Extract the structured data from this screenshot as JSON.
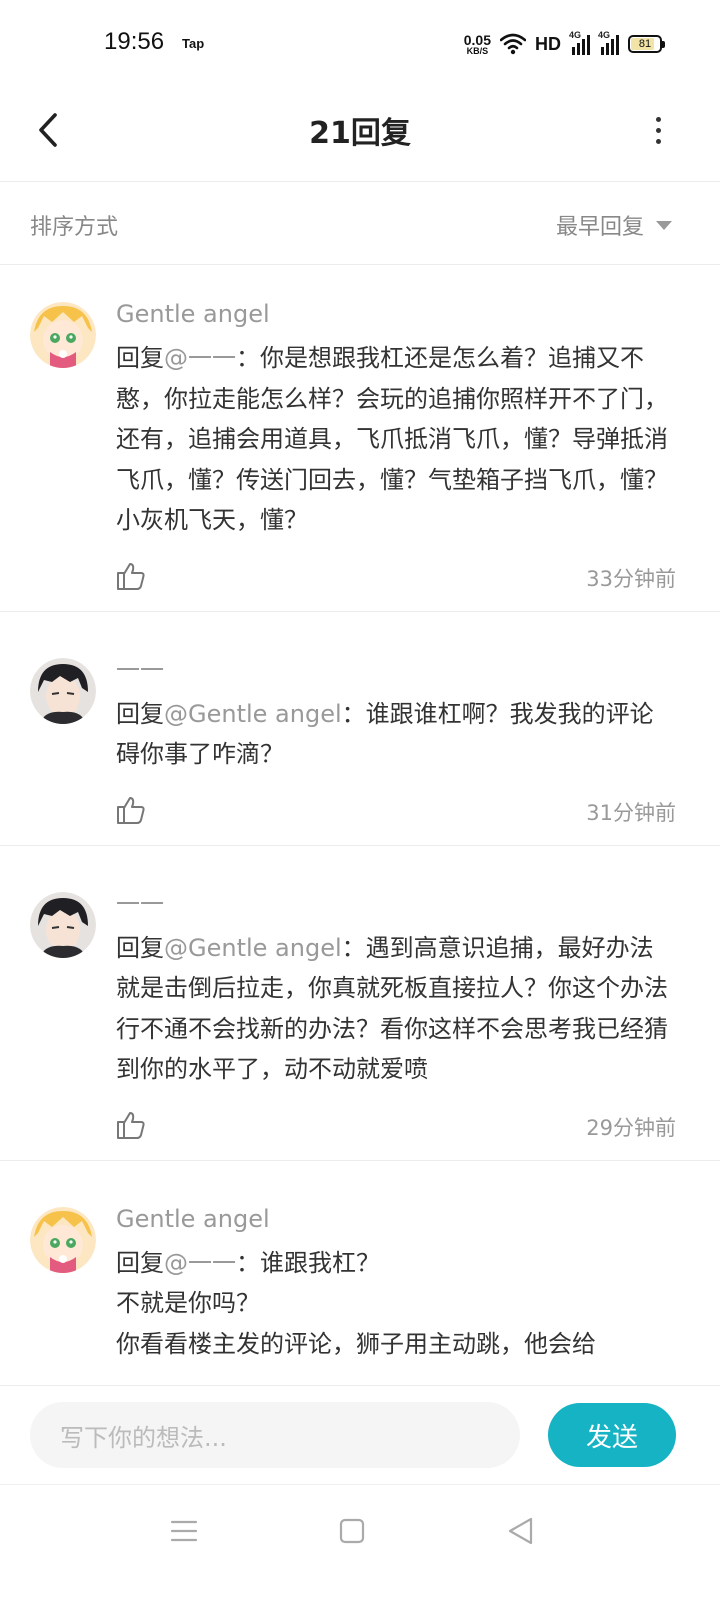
{
  "status_bar": {
    "time": "19:56",
    "app_label": "Tap",
    "net_speed_value": "0.05",
    "net_speed_unit": "KB/S",
    "hd_label": "HD",
    "sim1_label": "4G",
    "sim2_label": "4G",
    "battery_level": "81"
  },
  "header": {
    "title": "21回复"
  },
  "sort": {
    "label": "排序方式",
    "selected": "最早回复"
  },
  "comments": [
    {
      "username": "Gentle angel",
      "reply_prefix": "回复",
      "mention": "@一一",
      "text": "：你是想跟我杠还是怎么着？追捕又不憨，你拉走能怎么样？会玩的追捕你照样开不了门，还有，追捕会用道具，飞爪抵消飞爪，懂？导弹抵消飞爪，懂？传送门回去，懂？气垫箱子挡飞爪，懂？小灰机飞天，懂？",
      "time": "33分钟前",
      "avatar": "anime-girl"
    },
    {
      "username": "一一",
      "reply_prefix": "回复",
      "mention": "@Gentle angel",
      "text": "：谁跟谁杠啊？我发我的评论碍你事了咋滴？",
      "time": "31分钟前",
      "avatar": "dark-hair-boy"
    },
    {
      "username": "一一",
      "reply_prefix": "回复",
      "mention": "@Gentle angel",
      "text": "：遇到高意识追捕，最好办法就是击倒后拉走，你真就死板直接拉人？你这个办法行不通不会找新的办法？看你这样不会思考我已经猜到你的水平了，动不动就爱喷",
      "time": "29分钟前",
      "avatar": "dark-hair-boy"
    },
    {
      "username": "Gentle angel",
      "reply_prefix": "回复",
      "mention": "@一一",
      "text_lines": [
        "：谁跟我杠？",
        "不就是你吗？",
        "你看看楼主发的评论，狮子用主动跳，他会给"
      ],
      "avatar": "anime-girl"
    }
  ],
  "input": {
    "placeholder": "写下你的想法...",
    "send_label": "发送"
  },
  "colors": {
    "accent": "#16b3c4",
    "secondary_text": "#999999",
    "primary_text": "#333333"
  },
  "icons": {
    "back": "chevron-left-icon",
    "more": "more-vertical-icon",
    "like": "thumbs-up-icon",
    "nav_menu": "menu-icon",
    "nav_home": "square-icon",
    "nav_back": "triangle-back-icon"
  }
}
